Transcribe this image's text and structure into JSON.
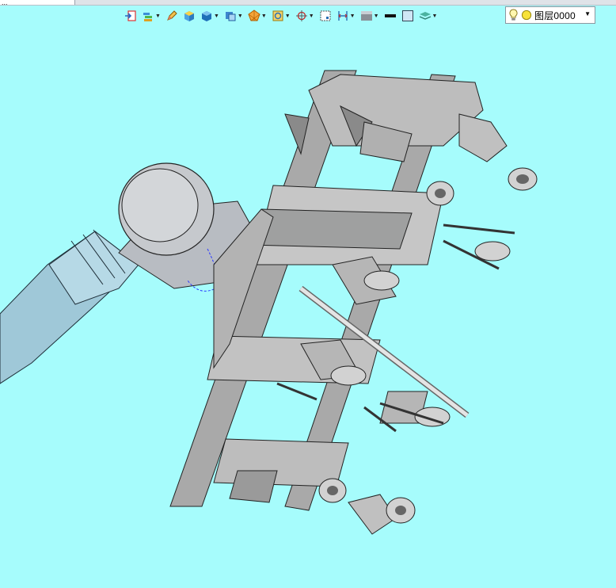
{
  "app": {
    "doc_tab_label": "...",
    "colors": {
      "viewport_bg": "#a6fcfc",
      "frame_gray": "#b5b5b5",
      "arm_blue": "#9fc8d8"
    }
  },
  "toolbar": {
    "buttons": [
      {
        "name": "import-icon",
        "has_menu": false
      },
      {
        "name": "layers-stack-icon",
        "has_menu": true
      },
      {
        "name": "pencil-icon",
        "has_menu": false
      },
      {
        "name": "solid-cube-icon",
        "has_menu": false
      },
      {
        "name": "render-cube-icon",
        "has_menu": true
      },
      {
        "name": "view-cube-icon",
        "has_menu": true
      },
      {
        "name": "polygon-icon",
        "has_menu": true
      },
      {
        "name": "frame-icon",
        "has_menu": true
      },
      {
        "name": "snap-icon",
        "has_menu": true
      },
      {
        "name": "rect-select-icon",
        "has_menu": false
      },
      {
        "name": "dimension-icon",
        "has_menu": true
      },
      {
        "name": "shade-icon",
        "has_menu": true
      },
      {
        "name": "line-weight-icon",
        "has_menu": false
      },
      {
        "name": "color-swatch-icon",
        "has_menu": false
      },
      {
        "name": "layer-manager-icon",
        "has_menu": true
      }
    ],
    "layer_select": {
      "value": "图层0000",
      "bulb_icon": "lightbulb-icon",
      "state_icon": "layer-on-icon"
    }
  }
}
